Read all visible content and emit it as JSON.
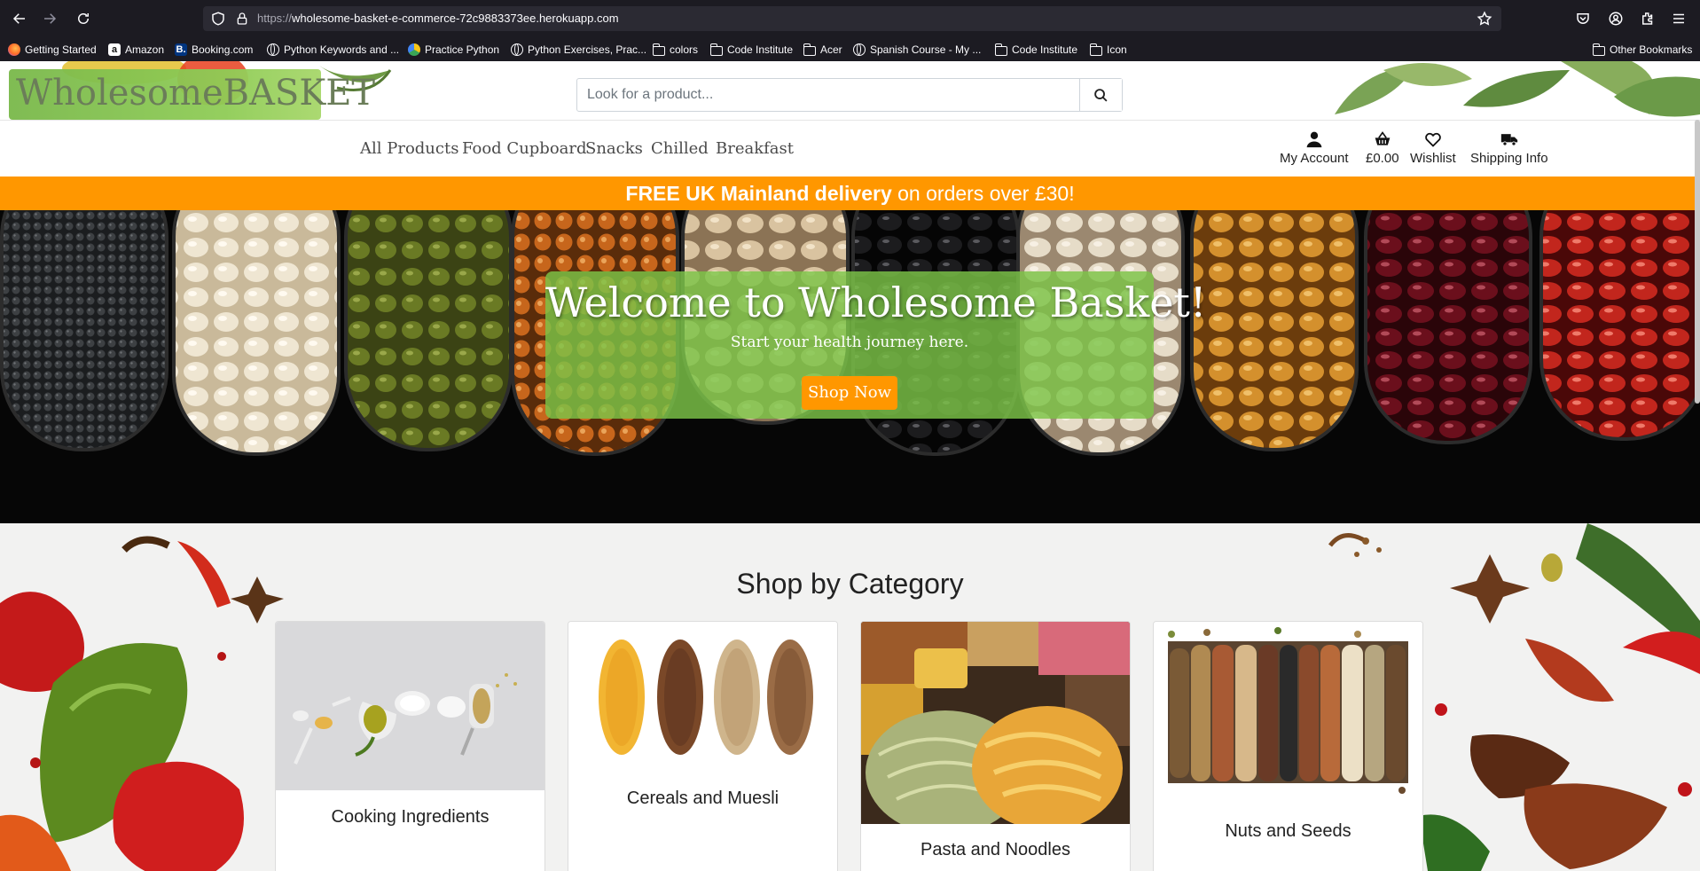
{
  "browser": {
    "url_protocol": "https://",
    "url_host": "wholesome-basket-e-commerce-72c9883373ee.herokuapp.com",
    "bookmarks": [
      {
        "label": "Getting Started",
        "icon": "firefox-icon"
      },
      {
        "label": "Amazon",
        "icon": "amazon-icon"
      },
      {
        "label": "Booking.com",
        "icon": "booking-icon"
      },
      {
        "label": "Python Keywords and ...",
        "icon": "globe-icon"
      },
      {
        "label": "Practice Python",
        "icon": "practice-python-icon"
      },
      {
        "label": "Python Exercises, Prac...",
        "icon": "globe-icon"
      },
      {
        "label": "colors",
        "icon": "folder-icon"
      },
      {
        "label": "Code Institute",
        "icon": "folder-icon"
      },
      {
        "label": "Acer",
        "icon": "folder-icon"
      },
      {
        "label": "Spanish Course - My ...",
        "icon": "globe-icon"
      },
      {
        "label": "Code Institute",
        "icon": "folder-icon"
      },
      {
        "label": "Icon",
        "icon": "folder-icon"
      }
    ],
    "other_bookmarks": "Other Bookmarks"
  },
  "site": {
    "logo": "WholesomeBASKET",
    "search_placeholder": "Look for a product...",
    "nav": [
      "All Products",
      "Food Cupboard",
      "Snacks",
      "Chilled",
      "Breakfast"
    ],
    "account": {
      "my_account": "My Account",
      "basket_total": "£0.00",
      "wishlist": "Wishlist",
      "shipping": "Shipping Info"
    },
    "promo_bold": "FREE UK Mainland delivery",
    "promo_rest": "on orders over £30!",
    "colors": {
      "accent": "#ff9700",
      "brand_green": "#7dc448"
    }
  },
  "hero": {
    "title": "Welcome to Wholesome Basket!",
    "subtitle": "Start your health journey here.",
    "button": "Shop Now"
  },
  "categories": {
    "title": "Shop by Category",
    "items": [
      {
        "label": "Cooking Ingredients"
      },
      {
        "label": "Cereals and Muesli"
      },
      {
        "label": "Pasta and Noodles"
      },
      {
        "label": "Nuts and Seeds"
      }
    ]
  }
}
